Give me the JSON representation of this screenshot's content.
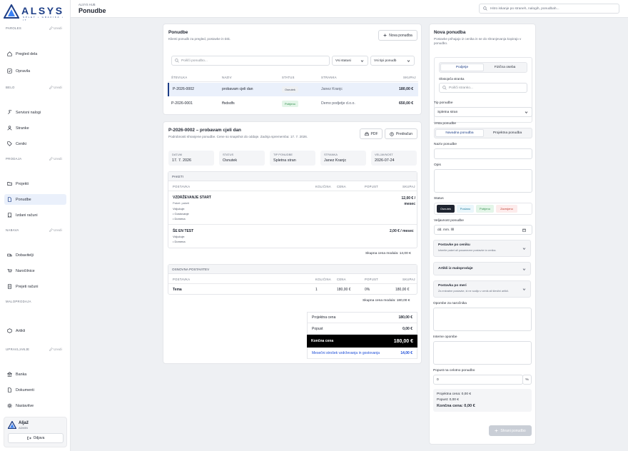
{
  "brand": {
    "name": "ALSYS",
    "tagline": "SPLET • GRAFIKA • IT",
    "color": "#1d3e87"
  },
  "sidebar": {
    "sections": [
      {
        "title": "PAROLES",
        "edit": "Uredi"
      },
      {
        "title": "BELO",
        "edit": "Uredi"
      },
      {
        "title": "PRODAJA",
        "edit": "Uredi"
      },
      {
        "title": "NABAVA",
        "edit": "Uredi"
      },
      {
        "title": "MALOPRODAJA",
        "edit": ""
      },
      {
        "title": "UPRAVLJANJE",
        "edit": "Uredi"
      }
    ],
    "items": [
      {
        "label": "Pregled dela",
        "icon": "home-icon"
      },
      {
        "label": "Opravila",
        "icon": "task-icon"
      },
      {
        "label": "Servisni nalogi",
        "icon": "wrench-icon"
      },
      {
        "label": "Stranke",
        "icon": "users-icon"
      },
      {
        "label": "Ceniki",
        "icon": "tag-icon"
      },
      {
        "label": "Projekti",
        "icon": "folder-icon"
      },
      {
        "label": "Ponudbe",
        "icon": "document-icon"
      },
      {
        "label": "Izdani računi",
        "icon": "invoice-icon"
      },
      {
        "label": "Dobavitelji",
        "icon": "truck-icon"
      },
      {
        "label": "Naročilnice",
        "icon": "cart-icon"
      },
      {
        "label": "Prejeti računi",
        "icon": "receipt-icon"
      },
      {
        "label": "Artikli",
        "icon": "box-icon"
      },
      {
        "label": "Banka",
        "icon": "bank-icon"
      },
      {
        "label": "Dokumenti",
        "icon": "file-icon"
      },
      {
        "label": "Nastavitve",
        "icon": "gear-icon"
      }
    ],
    "user": {
      "name": "Aljaž",
      "role": "ADMIN",
      "logout": "Odjava"
    }
  },
  "topbar": {
    "breadcrumb": "ALSYS HUB",
    "title": "Ponudbe",
    "search_placeholder": "Hitro iskanje po straneh, nalogih, ponudbah..."
  },
  "offers": {
    "title": "Ponudbe",
    "subtitle": "Klienti ponudb za pregled, postavke in tisk.",
    "new_button": "Nova ponudba",
    "search_placeholder": "Poišči ponudbo...",
    "status_filter": "Vsi statusi",
    "type_filter": "Vsi tipi ponudb",
    "columns": [
      "ŠTEVILKA",
      "NAZIV",
      "STATUS",
      "STRANKA",
      "SKUPAJ"
    ],
    "rows": [
      {
        "number": "P-2026-0002",
        "name": "probavam cjeli dan",
        "status": "Osnutek",
        "client": "Janez Kranjc",
        "total": "180,00 €"
      },
      {
        "number": "P-2026-0001",
        "name": "ffsdsdfs",
        "status": "Potrjeno",
        "client": "Demo podjetje d.o.o.",
        "total": "650,00 €"
      }
    ]
  },
  "detail": {
    "title": "P-2026-0002 – probavam cjeli dan",
    "subtitle": "Podrobnosti shranjene ponudbe. Cene so snapshot do oddaje. Zadnja sprememba: 17. 7. 2026.",
    "pdf": "PDF",
    "invoice": "Predračun",
    "cards": [
      {
        "label": "DATUM",
        "value": "17. 7. 2026"
      },
      {
        "label": "STATUS",
        "value": "Osnutek"
      },
      {
        "label": "TIP PONUDBE",
        "value": "Spletna stran"
      },
      {
        "label": "STRANKA",
        "value": "Janez Kranjc"
      },
      {
        "label": "VELJAVNOST",
        "value": "2026-07-24"
      }
    ],
    "packages": {
      "title": "PAKETI",
      "columns": [
        "POSTAVKA",
        "KOLIČINA",
        "CENA",
        "POPUST",
        "SKUPAJ"
      ],
      "items": [
        {
          "name": "VZDRŽEVANJE START",
          "desc": "Paket: paketi",
          "incl": "Vključuje:",
          "bullets": [
            "Gostovanje",
            "Domena"
          ],
          "total": "12,00 € / mesec"
        },
        {
          "name": "ŠE EN TEST",
          "incl": "Vključuje:",
          "bullets": [
            "Domena"
          ],
          "total": "2,00 € / mesec"
        }
      ],
      "module_total": "Skupna cena modula: 14,00 €"
    },
    "basic": {
      "title": "OSNOVNA POSTAVITEV",
      "columns": [
        "POSTAVKA",
        "KOLIČINA",
        "CENA",
        "POPUST",
        "SKUPAJ"
      ],
      "row": {
        "name": "Tema",
        "qty": "1",
        "price": "180,00 €",
        "discount": "0%",
        "total": "180,00 €"
      },
      "module_total": "Skupna cena modula: 180,00 €"
    },
    "summary": {
      "project_label": "Projektna cena",
      "project_value": "180,00 €",
      "discount_label": "Popust",
      "discount_value": "0,00 €",
      "final_label": "Končna cena",
      "final_value": "180,00 €",
      "monthly_label": "Mesečni strošek vzdrževanja in gostovanja",
      "monthly_value": "14,00 €"
    }
  },
  "form": {
    "title": "Nova ponudba",
    "subtitle": "Postavke prihajajo iz cenika in se do shranjevanja kopirajo v ponudbo.",
    "client_tabs": [
      "Podjetje",
      "Fizična oseba"
    ],
    "client_label": "Obstoječa stranka",
    "client_placeholder": "Poišči stranko...",
    "type_label": "Tip ponudbe",
    "type_value": "Spletna stran",
    "kind_label": "Vrsta ponudbe",
    "kind_tabs": [
      "Navadna ponudba",
      "Projektna ponudba"
    ],
    "name_label": "Naziv ponudbe",
    "desc_label": "Opis",
    "status_label": "Status",
    "statuses": [
      "Osnutek",
      "Poslano",
      "Potrjeno",
      "Zavrnjeno"
    ],
    "valid_label": "Veljavnost ponudbe",
    "valid_placeholder": "dd. mm. llll",
    "acc1_title": "Postavke po ceniku",
    "acc1_sub": "Izberite paket ali posamezne postavke iz cenika.",
    "acc2_title": "Artikli iz maloprodaje",
    "acc3_title": "Postavka po meri",
    "acc3_sub": "Za enkratne postavke, ki ne sodijo v cenik ali številni artikli.",
    "note_label": "Opombe za naročnika",
    "internal_label": "Interne opombe",
    "discount_label": "Popust na celotno ponudbo",
    "discount_value": "0",
    "discount_unit": "%",
    "proj_line": "Projektna cena: 0,00 €",
    "disc_line": "Popust: 0,00 €",
    "final_line": "Končna cena: 0,00 €",
    "save": "Shrani ponudbo"
  }
}
